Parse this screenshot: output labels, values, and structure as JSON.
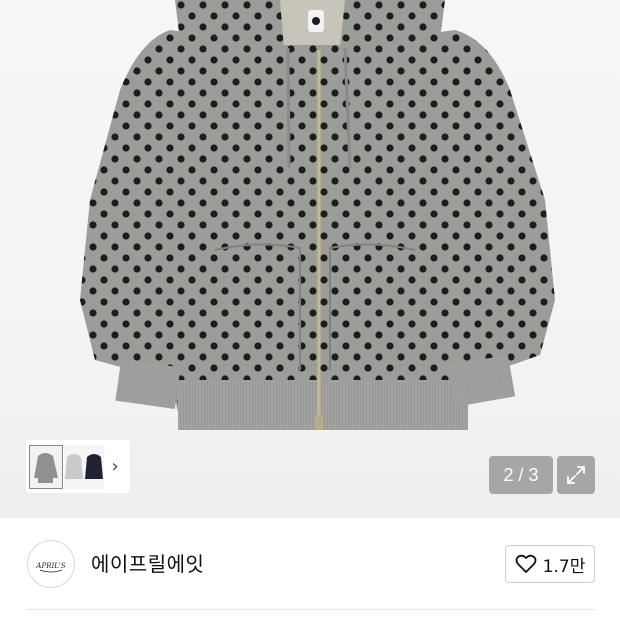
{
  "gallery": {
    "product_image_desc": "hoodie-photo",
    "counter_current": "2",
    "counter_separator": "/",
    "counter_total": "3",
    "thumbnails": [
      {
        "name": "thumb-gray-dot-hoodie",
        "color": "#8f918c"
      },
      {
        "name": "thumb-light-gray-hoodie",
        "color": "#c9cacc"
      },
      {
        "name": "thumb-navy-hoodie",
        "color": "#1e2233"
      }
    ],
    "next_icon": "chevron-right-icon",
    "expand_icon": "expand-icon"
  },
  "brand": {
    "logo_icon": "brand-logo",
    "name": "에이프릴에잇",
    "like_icon": "heart-icon",
    "like_count": "1.7만"
  },
  "colors": {
    "hoodie_gray": "#9a9b97",
    "dot": "#1c1d1d",
    "counter_bg": "#8f8f8f"
  }
}
